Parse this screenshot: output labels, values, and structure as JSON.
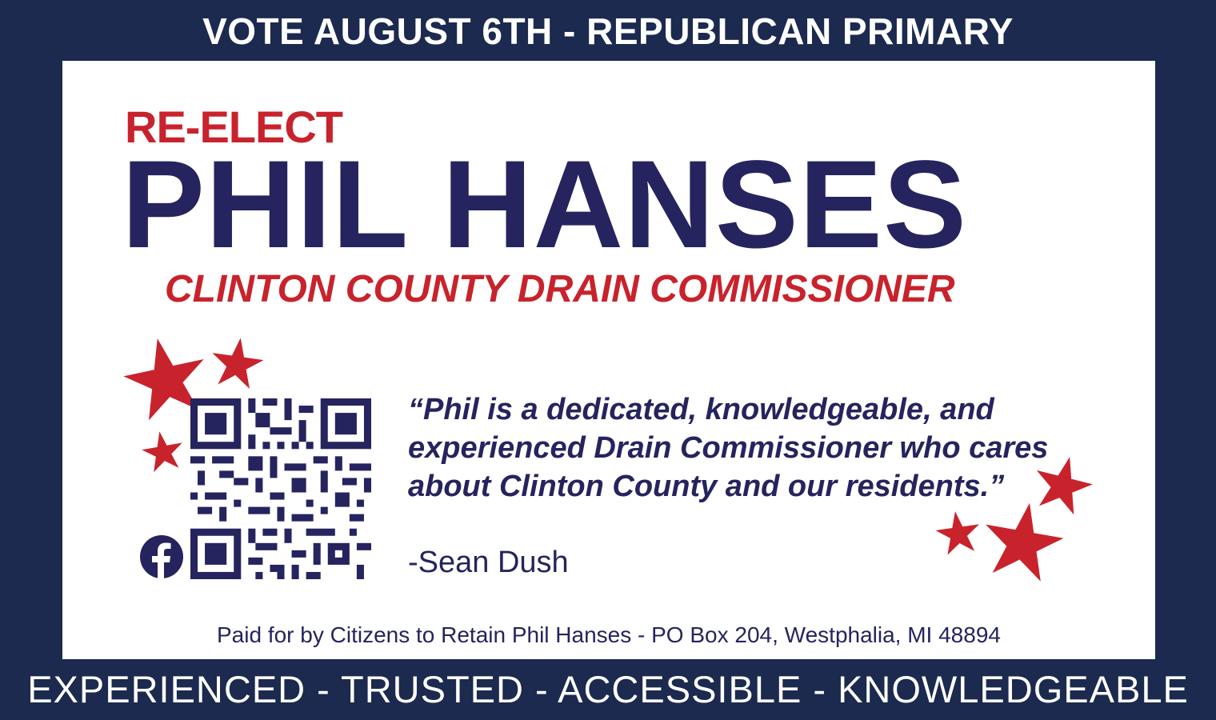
{
  "colors": {
    "navy_border": "#1b2a4e",
    "navy_text": "#25245e",
    "red": "#c8232c",
    "white": "#ffffff"
  },
  "top_banner": "VOTE AUGUST 6TH - REPUBLICAN PRIMARY",
  "headline": {
    "pre_title": "RE-ELECT",
    "name": "PHIL HANSES",
    "office": "CLINTON COUNTY DRAIN COMMISSIONER"
  },
  "quote": {
    "text": "“Phil is a dedicated, knowledgeable, and experienced Drain Commissioner who cares about Clinton County and our residents.”",
    "attribution": "-Sean Dush"
  },
  "icons": {
    "qr": "qr-code-icon",
    "facebook": "facebook-icon",
    "stars": "star-icon"
  },
  "disclaimer": "Paid for by Citizens to Retain Phil Hanses - PO Box 204, Westphalia, MI 48894",
  "bottom_banner": "EXPERIENCED - TRUSTED - ACCESSIBLE - KNOWLEDGEABLE"
}
